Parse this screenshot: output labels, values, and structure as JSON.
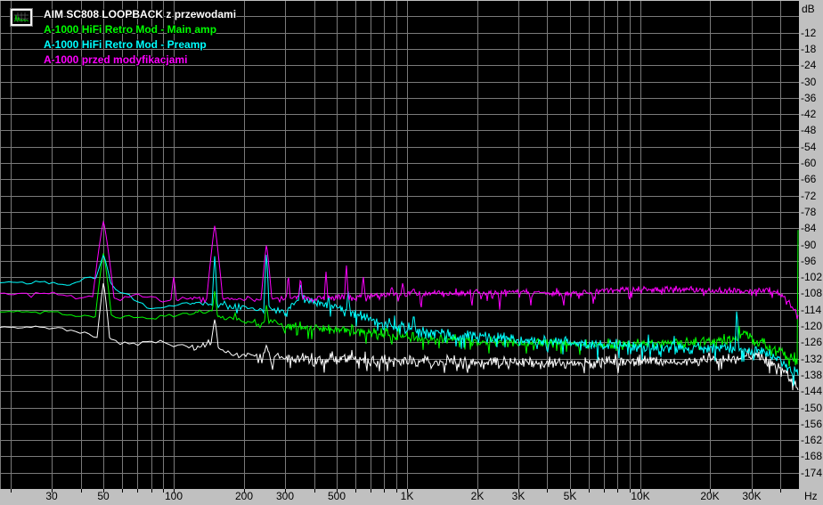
{
  "chart_data": {
    "type": "line",
    "description": "Audio noise spectrum analysis (FFT) with four overlaid traces on log-frequency axis",
    "colors": {
      "background": "#000000",
      "grid": "#7a7a7a",
      "axis_bg": "#c0c0c0",
      "axis_text": "#000000",
      "tick": "#000000",
      "top_edge": "#c0c0c0"
    },
    "x_axis": {
      "unit": "Hz",
      "scale": "log",
      "min": 18,
      "max": 48000,
      "gridlines": [
        20,
        30,
        40,
        50,
        60,
        70,
        80,
        90,
        100,
        200,
        300,
        400,
        500,
        600,
        700,
        800,
        900,
        1000,
        2000,
        3000,
        4000,
        5000,
        6000,
        7000,
        8000,
        9000,
        10000,
        20000,
        30000,
        40000
      ],
      "labeled_ticks": [
        {
          "f": 30,
          "label": "30"
        },
        {
          "f": 50,
          "label": "50"
        },
        {
          "f": 100,
          "label": "100"
        },
        {
          "f": 200,
          "label": "200"
        },
        {
          "f": 300,
          "label": "300"
        },
        {
          "f": 500,
          "label": "500"
        },
        {
          "f": 1000,
          "label": "1K"
        },
        {
          "f": 2000,
          "label": "2K"
        },
        {
          "f": 3000,
          "label": "3K"
        },
        {
          "f": 5000,
          "label": "5K"
        },
        {
          "f": 10000,
          "label": "10K"
        },
        {
          "f": 20000,
          "label": "20K"
        },
        {
          "f": 30000,
          "label": "30K"
        }
      ]
    },
    "y_axis": {
      "unit": "dB",
      "min": -180,
      "max": 0,
      "grid_step": 6,
      "labels": [
        "-12",
        "-18",
        "-24",
        "-30",
        "-36",
        "-42",
        "-48",
        "-54",
        "-60",
        "-66",
        "-72",
        "-78",
        "-84",
        "-90",
        "-96",
        "-102",
        "-108",
        "-114",
        "-120",
        "-126",
        "-132",
        "-138",
        "-144",
        "-150",
        "-156",
        "-162",
        "-168",
        "-174"
      ]
    },
    "series": [
      {
        "name": "AIM SC808 LOOPBACK z przewodami",
        "color": "#ffffff",
        "baseline": [
          [
            18,
            -120.5
          ],
          [
            28,
            -120.5
          ],
          [
            36,
            -121.5
          ],
          [
            44,
            -123.5
          ],
          [
            50,
            -124
          ],
          [
            58,
            -126
          ],
          [
            70,
            -126.5
          ],
          [
            80,
            -124.5
          ],
          [
            90,
            -126
          ],
          [
            100,
            -127
          ],
          [
            115,
            -127.5
          ],
          [
            130,
            -128
          ],
          [
            145,
            -126
          ],
          [
            160,
            -129
          ],
          [
            180,
            -130.5
          ],
          [
            200,
            -131
          ],
          [
            250,
            -131
          ],
          [
            300,
            -131.5
          ],
          [
            400,
            -132.5
          ],
          [
            550,
            -132
          ],
          [
            700,
            -133
          ],
          [
            1000,
            -133
          ],
          [
            1600,
            -133.5
          ],
          [
            3000,
            -133.5
          ],
          [
            6000,
            -133.5
          ],
          [
            10000,
            -133
          ],
          [
            15000,
            -133
          ],
          [
            20000,
            -132.5
          ],
          [
            26000,
            -132
          ],
          [
            28500,
            -131
          ],
          [
            30000,
            -130.5
          ],
          [
            32000,
            -131
          ],
          [
            34000,
            -132
          ],
          [
            37000,
            -133.5
          ],
          [
            41000,
            -136
          ],
          [
            44000,
            -139
          ],
          [
            46000,
            -141
          ],
          [
            48000,
            -143
          ]
        ],
        "noise": [
          [
            18,
            0.5
          ],
          [
            45,
            0.9
          ],
          [
            140,
            1.5
          ],
          [
            250,
            2.3
          ],
          [
            1000,
            2.6
          ],
          [
            20000,
            2.4
          ],
          [
            30000,
            2.9
          ],
          [
            48000,
            1.8
          ]
        ],
        "spikes": [
          [
            50,
            -104,
            7
          ],
          [
            150,
            -117.5,
            4
          ],
          [
            250,
            -127,
            3
          ]
        ]
      },
      {
        "name": "A-1000 HiFi Retro Mod - Main amp",
        "color": "#00ff00",
        "baseline": [
          [
            18,
            -115
          ],
          [
            30,
            -114.5
          ],
          [
            40,
            -116.5
          ],
          [
            50,
            -116
          ],
          [
            60,
            -117
          ],
          [
            70,
            -116.5
          ],
          [
            80,
            -117.5
          ],
          [
            90,
            -116.5
          ],
          [
            100,
            -116.5
          ],
          [
            120,
            -115.5
          ],
          [
            140,
            -114.5
          ],
          [
            160,
            -117
          ],
          [
            180,
            -117.5
          ],
          [
            200,
            -118
          ],
          [
            240,
            -119.5
          ],
          [
            270,
            -118
          ],
          [
            300,
            -120
          ],
          [
            350,
            -120.5
          ],
          [
            400,
            -121
          ],
          [
            500,
            -121.5
          ],
          [
            600,
            -122
          ],
          [
            700,
            -122.5
          ],
          [
            850,
            -123.5
          ],
          [
            1000,
            -124
          ],
          [
            1400,
            -125
          ],
          [
            2000,
            -125.5
          ],
          [
            3000,
            -126
          ],
          [
            4500,
            -126.5
          ],
          [
            6000,
            -127
          ],
          [
            8000,
            -127
          ],
          [
            10000,
            -126.5
          ],
          [
            13000,
            -126.5
          ],
          [
            17000,
            -126
          ],
          [
            20000,
            -126
          ],
          [
            24000,
            -125.5
          ],
          [
            26500,
            -124
          ],
          [
            28000,
            -122
          ],
          [
            29500,
            -124
          ],
          [
            31000,
            -125.5
          ],
          [
            33000,
            -126
          ],
          [
            36000,
            -127.5
          ],
          [
            40000,
            -129.5
          ],
          [
            43000,
            -131.5
          ],
          [
            45500,
            -133
          ],
          [
            47500,
            -134
          ]
        ],
        "noise": [
          [
            18,
            0.5
          ],
          [
            90,
            0.9
          ],
          [
            200,
            1.5
          ],
          [
            700,
            2.1
          ],
          [
            48000,
            2.1
          ]
        ],
        "spikes": [
          [
            50,
            -93,
            9
          ],
          [
            150,
            -107,
            3
          ],
          [
            250,
            -112,
            2.5
          ],
          [
            47900,
            -48,
            1.6
          ]
        ]
      },
      {
        "name": "A-1000 HiFi Retro Mod - Preamp",
        "color": "#00ffff",
        "baseline": [
          [
            18,
            -104
          ],
          [
            30,
            -104
          ],
          [
            36,
            -105
          ],
          [
            40,
            -102.5
          ],
          [
            44,
            -102
          ],
          [
            48,
            -103.5
          ],
          [
            55,
            -106
          ],
          [
            62,
            -108
          ],
          [
            70,
            -111
          ],
          [
            80,
            -113.5
          ],
          [
            90,
            -113
          ],
          [
            100,
            -112.5
          ],
          [
            120,
            -111.5
          ],
          [
            140,
            -112
          ],
          [
            160,
            -112.5
          ],
          [
            180,
            -113
          ],
          [
            200,
            -113
          ],
          [
            230,
            -113.5
          ],
          [
            260,
            -114
          ],
          [
            300,
            -114.5
          ],
          [
            350,
            -110
          ],
          [
            400,
            -111
          ],
          [
            450,
            -112
          ],
          [
            500,
            -113
          ],
          [
            600,
            -116
          ],
          [
            700,
            -118
          ],
          [
            800,
            -119
          ],
          [
            1000,
            -121
          ],
          [
            1300,
            -122.5
          ],
          [
            1700,
            -123.5
          ],
          [
            2200,
            -124
          ],
          [
            3000,
            -125
          ],
          [
            4000,
            -125.5
          ],
          [
            6000,
            -126.5
          ],
          [
            8000,
            -127
          ],
          [
            10000,
            -127.5
          ],
          [
            14000,
            -128
          ],
          [
            20000,
            -128
          ],
          [
            25000,
            -128.5
          ],
          [
            30000,
            -129
          ],
          [
            34000,
            -130
          ],
          [
            38000,
            -131.5
          ],
          [
            41000,
            -133
          ],
          [
            43500,
            -135.5
          ],
          [
            45500,
            -137
          ],
          [
            47000,
            -136.5
          ],
          [
            48000,
            -136
          ]
        ],
        "noise": [
          [
            18,
            0.6
          ],
          [
            120,
            0.9
          ],
          [
            250,
            1.8
          ],
          [
            700,
            2.5
          ],
          [
            48000,
            2.5
          ]
        ],
        "spikes": [
          [
            50,
            -94,
            9
          ],
          [
            150,
            -94,
            3
          ],
          [
            250,
            -93,
            3
          ],
          [
            350,
            -104,
            2
          ],
          [
            560,
            -107,
            2
          ],
          [
            1070,
            -115.5,
            2
          ],
          [
            26000,
            -113,
            2
          ]
        ]
      },
      {
        "name": "A-1000 przed modyfikacjami",
        "color": "#ff00ff",
        "baseline": [
          [
            18,
            -108
          ],
          [
            30,
            -108
          ],
          [
            40,
            -110
          ],
          [
            46,
            -109
          ],
          [
            50,
            -107.5
          ],
          [
            55,
            -110
          ],
          [
            60,
            -110
          ],
          [
            70,
            -108.5
          ],
          [
            80,
            -109
          ],
          [
            90,
            -111
          ],
          [
            100,
            -110
          ],
          [
            120,
            -110
          ],
          [
            140,
            -110
          ],
          [
            160,
            -110
          ],
          [
            200,
            -110
          ],
          [
            240,
            -110
          ],
          [
            260,
            -110
          ],
          [
            300,
            -110
          ],
          [
            350,
            -109.5
          ],
          [
            400,
            -110
          ],
          [
            500,
            -109.5
          ],
          [
            600,
            -109.5
          ],
          [
            700,
            -109
          ],
          [
            800,
            -108.5
          ],
          [
            1000,
            -108.5
          ],
          [
            1500,
            -108
          ],
          [
            2000,
            -108
          ],
          [
            3000,
            -107.5
          ],
          [
            5000,
            -108
          ],
          [
            7000,
            -107
          ],
          [
            10000,
            -106.5
          ],
          [
            15000,
            -107
          ],
          [
            20000,
            -107
          ],
          [
            25000,
            -107
          ],
          [
            30000,
            -107
          ],
          [
            33000,
            -107
          ],
          [
            36000,
            -107
          ],
          [
            39000,
            -107.5
          ],
          [
            42000,
            -110
          ],
          [
            44500,
            -112.5
          ],
          [
            46000,
            -114
          ],
          [
            47000,
            -115.5
          ],
          [
            48000,
            -116.5
          ]
        ],
        "noise": [
          [
            18,
            0.6
          ],
          [
            120,
            1.0
          ],
          [
            400,
            1.4
          ],
          [
            1000,
            1.3
          ],
          [
            48000,
            1.3
          ]
        ],
        "spikes": [
          [
            50,
            -81.5,
            12
          ],
          [
            100,
            -102,
            3
          ],
          [
            150,
            -83,
            9
          ],
          [
            250,
            -90,
            6
          ],
          [
            310,
            -101,
            2
          ],
          [
            350,
            -102,
            2
          ],
          [
            450,
            -100,
            2
          ],
          [
            550,
            -97,
            2
          ],
          [
            650,
            -101.5,
            2
          ],
          [
            860,
            -105.5,
            2
          ],
          [
            960,
            -104,
            2
          ],
          [
            1070,
            -106,
            2
          ],
          [
            1150,
            -114,
            1.5
          ],
          [
            1900,
            -113,
            1.5
          ],
          [
            2500,
            -114,
            1.5
          ],
          [
            3400,
            -112.5,
            1.5
          ],
          [
            4700,
            -113,
            1.5
          ],
          [
            6300,
            -112,
            1.5
          ],
          [
            9000,
            -111,
            1.5
          ]
        ]
      }
    ]
  },
  "legend_icon": {
    "name": "spectrum-thumbnail"
  }
}
